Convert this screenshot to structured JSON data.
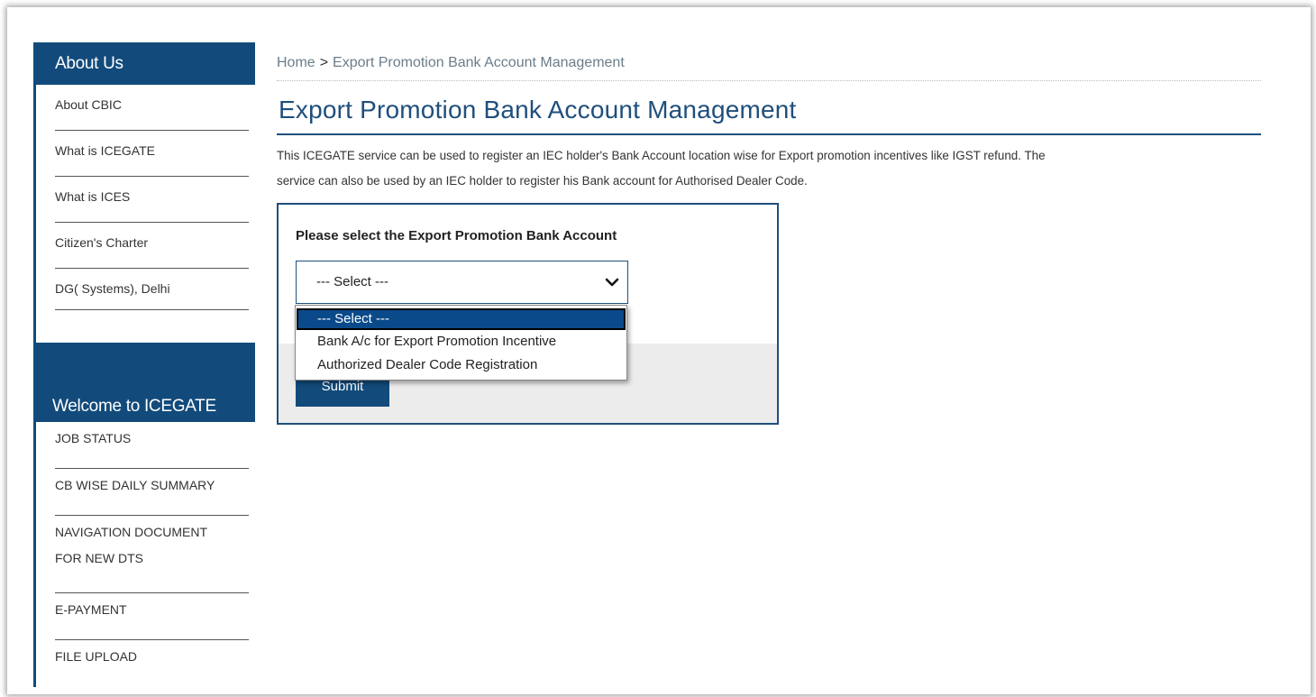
{
  "sidebar": {
    "about_title": "About Us",
    "about_items": [
      {
        "label": "About CBIC"
      },
      {
        "label": "What is ICEGATE"
      },
      {
        "label": "What is ICES"
      },
      {
        "label": "Citizen's Charter"
      },
      {
        "label": "DG( Systems), Delhi"
      }
    ],
    "welcome_title": "Welcome to ICEGATE",
    "welcome_items": [
      {
        "label": "JOB STATUS"
      },
      {
        "label": "CB WISE DAILY SUMMARY"
      },
      {
        "label": "NAVIGATION DOCUMENT",
        "label2": "FOR NEW DTS"
      },
      {
        "label": "E-PAYMENT"
      },
      {
        "label": "FILE UPLOAD"
      }
    ]
  },
  "breadcrumb": {
    "home": "Home",
    "separator": ">",
    "current": "Export Promotion Bank Account Management"
  },
  "page": {
    "title": "Export Promotion Bank Account Management",
    "description_line1": "This ICEGATE service can be used to register an IEC holder's Bank Account location wise for Export promotion incentives like IGST refund. The",
    "description_line2": "service can also be used by an IEC holder to register his Bank account for Authorised Dealer Code."
  },
  "form": {
    "label": "Please select the Export Promotion Bank Account",
    "select_value": "--- Select ---",
    "options": [
      "--- Select ---",
      "Bank A/c for Export Promotion Incentive",
      "Authorized Dealer Code Registration"
    ],
    "submit_label": "Submit"
  },
  "colors": {
    "brand": "#124b7b",
    "title": "#1f4f7c",
    "highlight": "#0a4a8a"
  },
  "icons": {
    "select_arrow": "chevron-down-icon"
  }
}
